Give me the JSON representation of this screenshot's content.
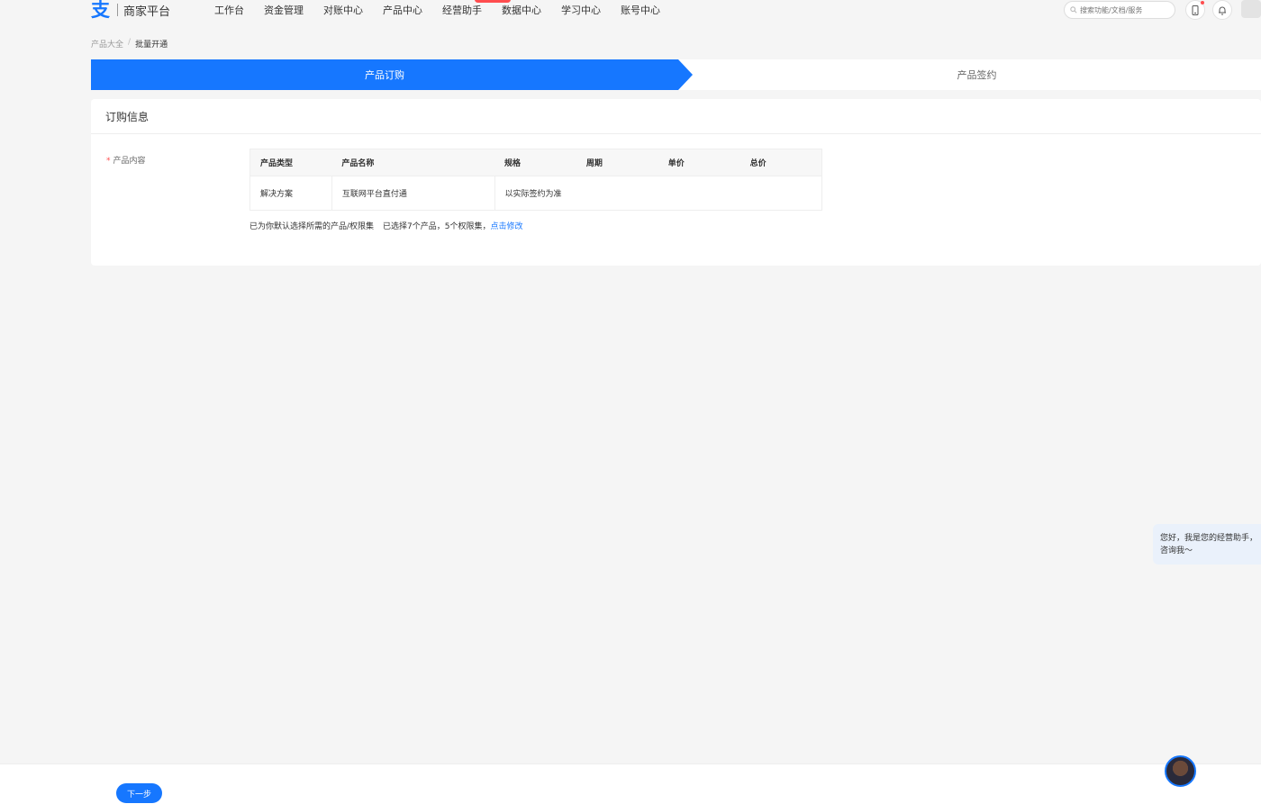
{
  "header": {
    "logo_text": "商家平台",
    "nav": [
      "工作台",
      "资金管理",
      "对账中心",
      "产品中心",
      "经营助手",
      "数据中心",
      "学习中心",
      "账号中心"
    ],
    "search_placeholder": "搜索功能/文档/服务"
  },
  "breadcrumb": {
    "parent": "产品大全",
    "separator": "/",
    "current": "批量开通"
  },
  "steps": [
    {
      "label": "产品订购",
      "active": true
    },
    {
      "label": "产品签约",
      "active": false
    }
  ],
  "order_info": {
    "title": "订购信息",
    "field_label": "产品内容",
    "table": {
      "headers": [
        "产品类型",
        "产品名称",
        "规格",
        "周期",
        "单价",
        "总价"
      ],
      "rows": [
        [
          "解决方案",
          "互联网平台直付通",
          "以实际签约为准",
          "",
          "",
          ""
        ]
      ]
    },
    "note_default": "已为你默认选择所需的产品/权限集",
    "note_selected": "已选择7个产品，5个权限集，",
    "note_link": "点击修改"
  },
  "assistant": {
    "line1": "您好，我是您的经营助手，",
    "line2": "咨询我～"
  },
  "footer": {
    "next_label": "下一步"
  },
  "colors": {
    "primary": "#1677ff",
    "required": "#ff4d4f",
    "background": "#f5f5f5"
  }
}
